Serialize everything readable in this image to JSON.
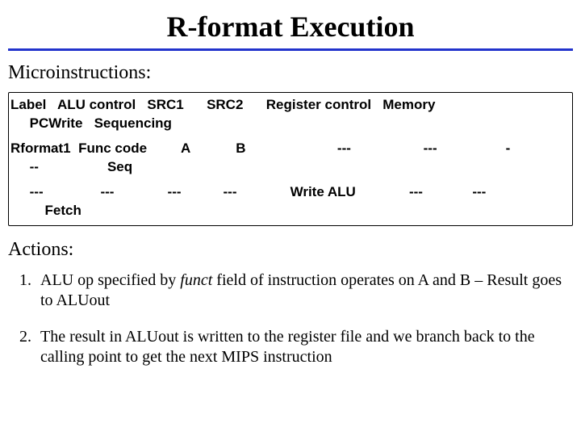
{
  "title": "R-format Execution",
  "sub_micro": "Microinstructions:",
  "table": {
    "header_line1": "Label   ALU control   SRC1      SRC2      Register control   Memory",
    "header_line2": "     PCWrite   Sequencing",
    "row1_line1": "Rformat1  Func code         A            B                        ---                   ---                  -",
    "row1_line2": "     --                  Seq",
    "row2_line1": "     ---               ---              ---           ---              Write ALU              ---             ---",
    "row2_line2": "         Fetch"
  },
  "sub_actions": "Actions:",
  "actions": {
    "item1_pre": "ALU op specified by ",
    "item1_funct": "funct",
    "item1_post": " field of instruction operates on A and B – Result goes to ALUout",
    "item2": "The result in ALUout is written to the register file and we branch back to the calling point to get the next MIPS instruction"
  }
}
